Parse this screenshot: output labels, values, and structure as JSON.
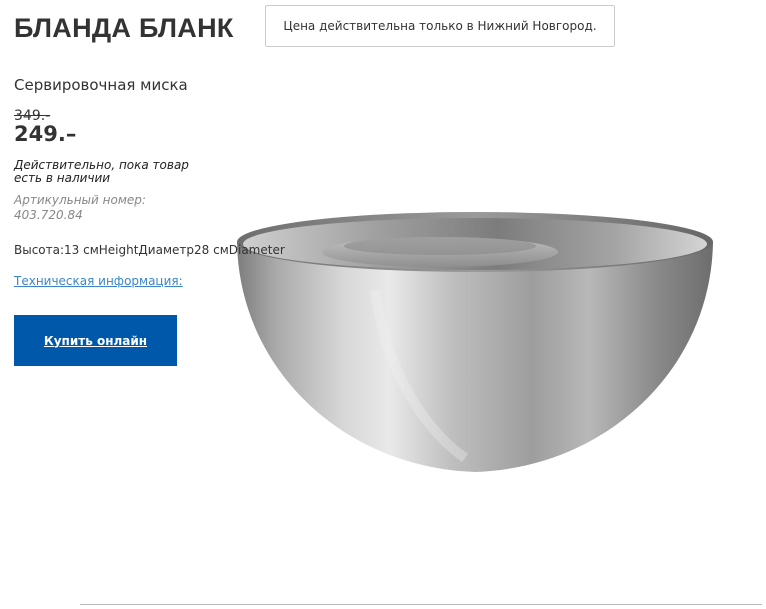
{
  "product": {
    "name": "БЛАНДА БЛАНК",
    "description": "Сервировочная миска",
    "old_price": "349.-",
    "price": "249.–",
    "availability": "Действительно, пока товар есть в наличии",
    "article_number": "Артикульный номер: 403.720.84",
    "dimensions": "Высота:13 смHeightДиаметр28 смDiameter",
    "tech_info_link": "Техническая информация:",
    "buy_button": "Купить онлайн",
    "image_icon": "steel-bowl-image"
  },
  "notice": {
    "text": "Цена действительна только в Нижний Новгород."
  },
  "colors": {
    "buy_button_bg": "#0058ab",
    "link": "#3a87c7",
    "text": "#333333",
    "muted": "#888888"
  }
}
